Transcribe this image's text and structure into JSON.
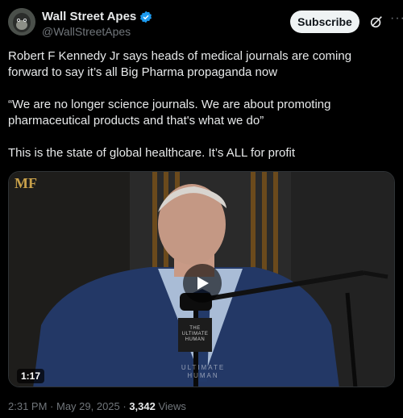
{
  "author": {
    "name": "Wall Street Apes",
    "handle": "@WallStreetApes",
    "verified_color": "#1d9bf0"
  },
  "actions": {
    "subscribe_label": "Subscribe",
    "grok_icon": "grok-icon",
    "more_icon": "more-icon"
  },
  "tweet": {
    "paragraphs": [
      "Robert F Kennedy Jr says heads of medical journals are coming forward to say it’s all Big Pharma propaganda now",
      "“We are no longer science journals. We are about promoting pharmaceutical products and that's what we do”",
      "This is the state of global healthcare. It’s ALL for profit"
    ]
  },
  "video": {
    "duration": "1:17",
    "logo_text": "MF",
    "mic_label": "THE ULTIMATE HUMAN",
    "watermark": "ULTIMATE HUMAN"
  },
  "meta": {
    "time": "2:31 PM",
    "separator": " · ",
    "date": "May 29, 2025",
    "views_count": "3,342",
    "views_label": " Views"
  }
}
